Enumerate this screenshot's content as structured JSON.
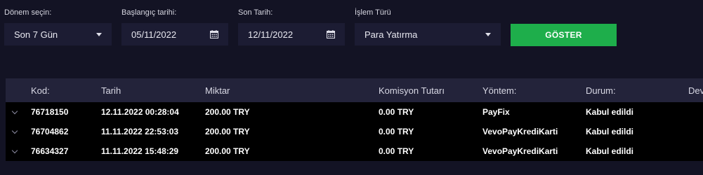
{
  "filters": {
    "period_label": "Dönem seçin:",
    "period_value": "Son 7 Gün",
    "start_label": "Başlangıç tarihi:",
    "start_value": "05/11/2022",
    "end_label": "Son Tarih:",
    "end_value": "12/11/2022",
    "type_label": "İşlem Türü",
    "type_value": "Para Yatırma",
    "show_button": "GÖSTER"
  },
  "table": {
    "headers": {
      "code": "Kod:",
      "date": "Tarih",
      "amount": "Miktar",
      "commission": "Komisyon Tutarı",
      "method": "Yöntem:",
      "status": "Durum:",
      "extra": "Dev"
    },
    "rows": [
      {
        "code": "76718150",
        "date": "12.11.2022 00:28:04",
        "amount": "200.00 TRY",
        "commission": "0.00 TRY",
        "method": "PayFix",
        "status": "Kabul edildi"
      },
      {
        "code": "76704862",
        "date": "11.11.2022 22:53:03",
        "amount": "200.00 TRY",
        "commission": "0.00 TRY",
        "method": "VevoPayKrediKarti",
        "status": "Kabul edildi"
      },
      {
        "code": "76634327",
        "date": "11.11.2022 15:48:29",
        "amount": "200.00 TRY",
        "commission": "0.00 TRY",
        "method": "VevoPayKrediKarti",
        "status": "Kabul edildi"
      }
    ]
  },
  "colors": {
    "background": "#131324",
    "field": "#1c1c33",
    "button": "#1eae4b",
    "header": "#23233a",
    "row": "#000000"
  }
}
